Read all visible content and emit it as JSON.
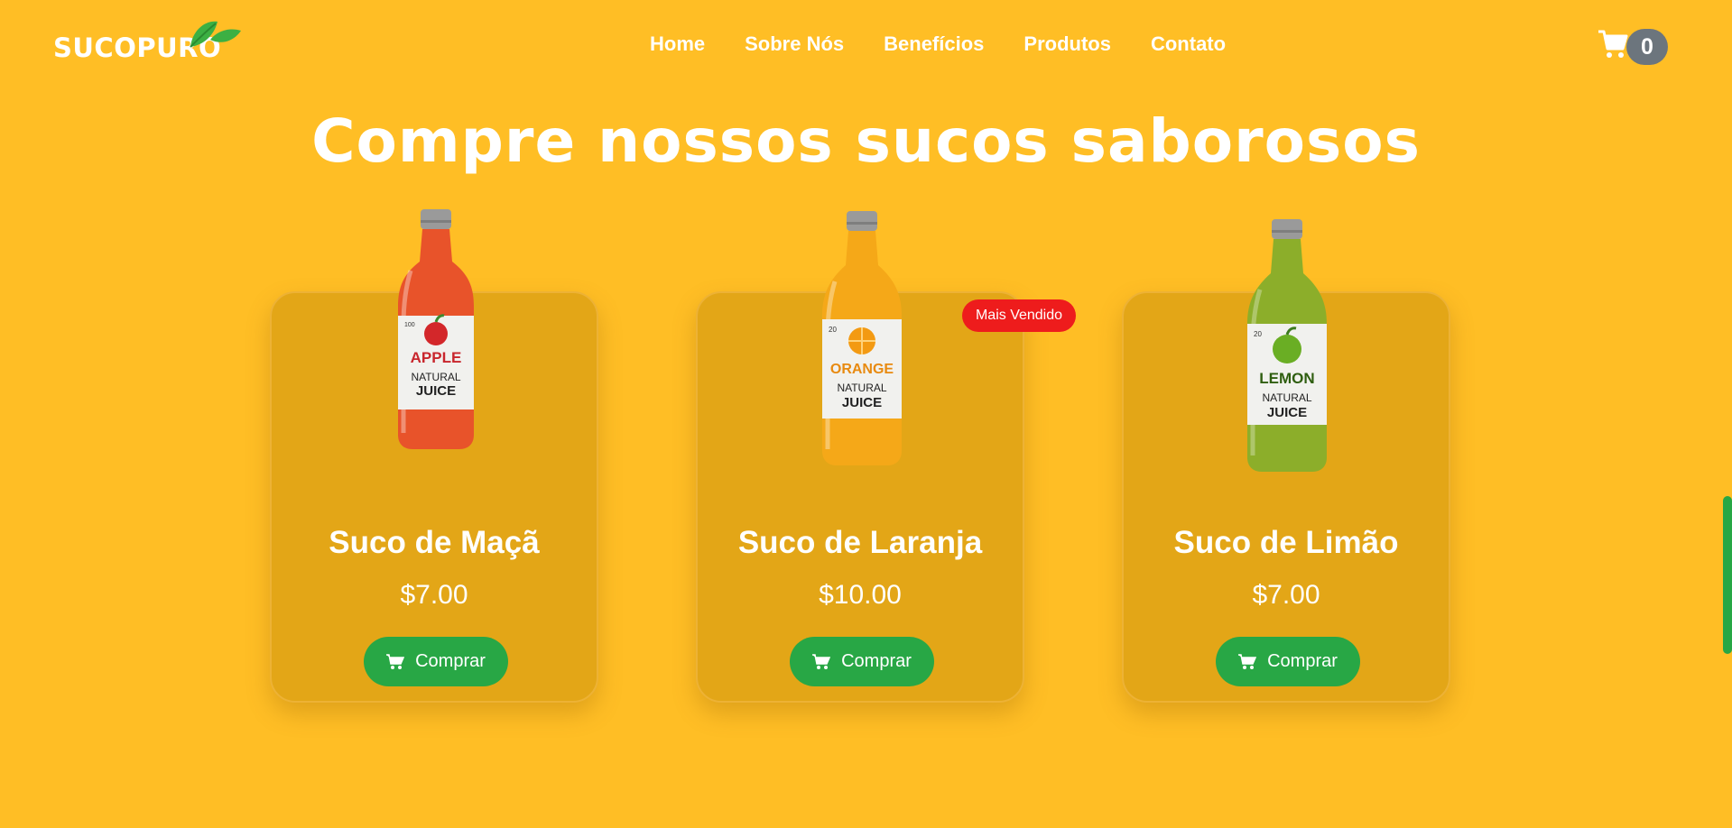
{
  "header": {
    "logo_text": "SUCOPURO",
    "nav": [
      "Home",
      "Sobre Nós",
      "Benefícios",
      "Produtos",
      "Contato"
    ],
    "cart_count": "0",
    "cart_icon": "cart-icon"
  },
  "products_section": {
    "title": "Compre nossos sucos saborosos",
    "products": [
      {
        "name": "Suco de Maçã",
        "price": "$7.00",
        "button": "Comprar",
        "bottle_color": "#E8532A",
        "label": {
          "brand": "APPLE",
          "line1": "NATURAL",
          "line2": "JUICE",
          "top": "100"
        }
      },
      {
        "name": "Suco de Laranja",
        "price": "$10.00",
        "button": "Comprar",
        "bottle_color": "#F5A818",
        "label": {
          "brand": "ORANGE",
          "line1": "NATURAL",
          "line2": "JUICE",
          "top": "20"
        }
      },
      {
        "name": "Suco de Limão",
        "price": "$7.00",
        "button": "Comprar",
        "bottle_color": "#8CAE2A",
        "label": {
          "brand": "LEMON",
          "line1": "NATURAL",
          "line2": "JUICE",
          "top": "20"
        }
      }
    ],
    "best_seller_badge": "Mais Vendido"
  },
  "colors": {
    "background": "#FFBE25",
    "card": "#E3A617",
    "button": "#28A745",
    "badge": "#EE1C1C",
    "cart_badge": "#6C757D"
  }
}
